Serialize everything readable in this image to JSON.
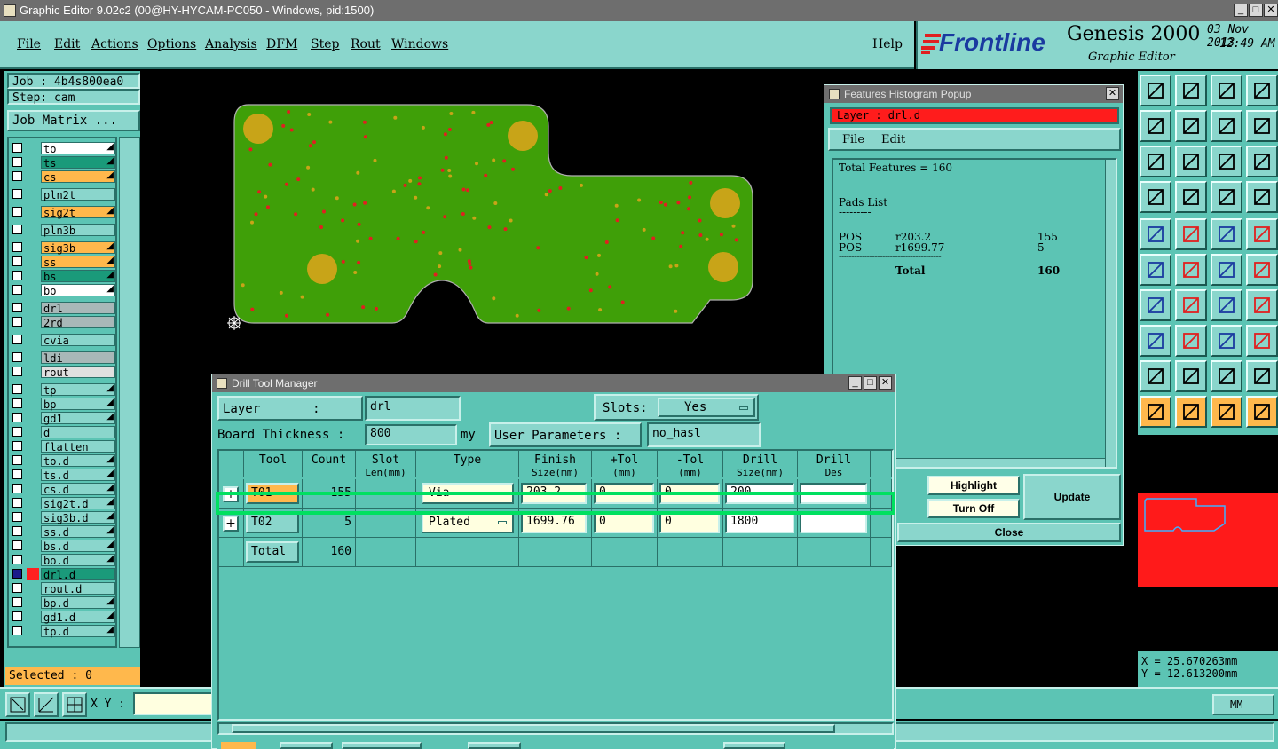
{
  "window": {
    "title": "Graphic Editor 9.02c2 (00@HY-HYCAM-PC050 - Windows, pid:1500)",
    "min": "_",
    "max": "□",
    "close": "✕"
  },
  "menu": [
    "File",
    "Edit",
    "Actions",
    "Options",
    "Analysis",
    "DFM",
    "Step",
    "Rout",
    "Windows"
  ],
  "help": "Help",
  "brand": {
    "logo": "Frontline",
    "product": "Genesis 2000",
    "subtitle": "Graphic Editor",
    "date": "03 Nov 2013",
    "time": "12:49 AM"
  },
  "job": {
    "job_label": "Job : 4b4s800ea0",
    "step_label": "Step: cam",
    "matrix_button": "Job Matrix ..."
  },
  "layers": [
    {
      "name": "to",
      "color": "#ffffff",
      "pen": true
    },
    {
      "name": "ts",
      "color": "#1a9a7a",
      "pen": true
    },
    {
      "name": "cs",
      "color": "#ffb84c",
      "pen": true
    },
    {
      "name": "pln2t",
      "color": "#8ad6cc",
      "pen": false
    },
    {
      "name": "sig2t",
      "color": "#ffb84c",
      "pen": true
    },
    {
      "name": "pln3b",
      "color": "#8ad6cc",
      "pen": false
    },
    {
      "name": "sig3b",
      "color": "#ffb84c",
      "pen": true
    },
    {
      "name": "ss",
      "color": "#ffb84c",
      "pen": true
    },
    {
      "name": "bs",
      "color": "#1a9a7a",
      "pen": true
    },
    {
      "name": "bo",
      "color": "#ffffff",
      "pen": true
    },
    {
      "name": "drl",
      "color": "#a8b8b8",
      "pen": false
    },
    {
      "name": "2rd",
      "color": "#a8b8b8",
      "pen": false
    },
    {
      "name": "cvia",
      "color": "#8ad6cc",
      "pen": false
    },
    {
      "name": "ldi",
      "color": "#a8b8b8",
      "pen": false
    },
    {
      "name": "rout",
      "color": "#e0e0e0",
      "pen": false
    },
    {
      "name": "tp",
      "color": "#8ad6cc",
      "pen": true
    },
    {
      "name": "bp",
      "color": "#8ad6cc",
      "pen": true
    },
    {
      "name": "gd1",
      "color": "#8ad6cc",
      "pen": true
    },
    {
      "name": "d",
      "color": "#8ad6cc",
      "pen": false
    },
    {
      "name": "flatten",
      "color": "#8ad6cc",
      "pen": false
    },
    {
      "name": "to.d",
      "color": "#8ad6cc",
      "pen": true
    },
    {
      "name": "ts.d",
      "color": "#8ad6cc",
      "pen": true
    },
    {
      "name": "cs.d",
      "color": "#8ad6cc",
      "pen": true
    },
    {
      "name": "sig2t.d",
      "color": "#8ad6cc",
      "pen": true
    },
    {
      "name": "sig3b.d",
      "color": "#8ad6cc",
      "pen": true
    },
    {
      "name": "ss.d",
      "color": "#8ad6cc",
      "pen": true
    },
    {
      "name": "bs.d",
      "color": "#8ad6cc",
      "pen": true
    },
    {
      "name": "bo.d",
      "color": "#8ad6cc",
      "pen": true
    },
    {
      "name": "drl.d",
      "color": "#1a9a7a",
      "pen": false,
      "active": true
    },
    {
      "name": "rout.d",
      "color": "#8ad6cc",
      "pen": false
    },
    {
      "name": "bp.d",
      "color": "#8ad6cc",
      "pen": true
    },
    {
      "name": "gd1.d",
      "color": "#8ad6cc",
      "pen": true
    },
    {
      "name": "tp.d",
      "color": "#8ad6cc",
      "pen": true
    }
  ],
  "selected": "Selected : 0",
  "histogram": {
    "title": "Features Histogram Popup",
    "layer": "Layer :  drl.d",
    "menu": [
      "File",
      "Edit"
    ],
    "total": "Total Features = 160",
    "pads_title": "Pads List",
    "underline": "---------",
    "rows": [
      {
        "type": "POS",
        "sym": "r203.2",
        "count": "155"
      },
      {
        "type": "POS",
        "sym": "r1699.77",
        "count": "5"
      }
    ],
    "rule": "----------------------------------------",
    "total_label": "Total",
    "total_value": "160",
    "highlight": "Highlight",
    "turn_off": "Turn Off",
    "update": "Update",
    "close": "Close"
  },
  "coords": {
    "x": "X =  25.670263mm",
    "y": "Y =  12.613200mm"
  },
  "xy_label": "X Y :",
  "units": "MM",
  "dtm": {
    "title": "Drill Tool Manager",
    "layer_label": "Layer       :",
    "layer_value": "drl",
    "slots_label": "Slots:",
    "slots_value": "Yes",
    "thickness_label": "Board Thickness :",
    "thickness_value": "800",
    "thickness_unit": "my",
    "user_params_label": "User Parameters :",
    "user_params_value": "no_hasl",
    "headers": [
      "Tool",
      "Count",
      "Slot\nLen(mm)",
      "Type",
      "Finish\nSize(mm)",
      "+Tol\n(mm)",
      "-Tol\n(mm)",
      "Drill\nSize(mm)",
      "Drill\nDes"
    ],
    "rows": [
      {
        "tool": "T01",
        "count": "155",
        "type": "Via",
        "finish": "203.2",
        "ptol": "0",
        "mtol": "0",
        "drill": "200",
        "des": "",
        "expand": "+"
      },
      {
        "tool": "T02",
        "count": "5",
        "type": "Plated",
        "finish": "1699.76",
        "ptol": "0",
        "mtol": "0",
        "drill": "1800",
        "des": "",
        "expand": "+"
      }
    ],
    "total_label": "Total",
    "total_value": "160"
  },
  "colors": {
    "panel": "#5cc4b4",
    "panel_light": "#8ad6cc",
    "board": "#3f9f08",
    "pad": "#c8a418",
    "highlight_box": "#00e060",
    "active_layer": "#ff2020"
  }
}
